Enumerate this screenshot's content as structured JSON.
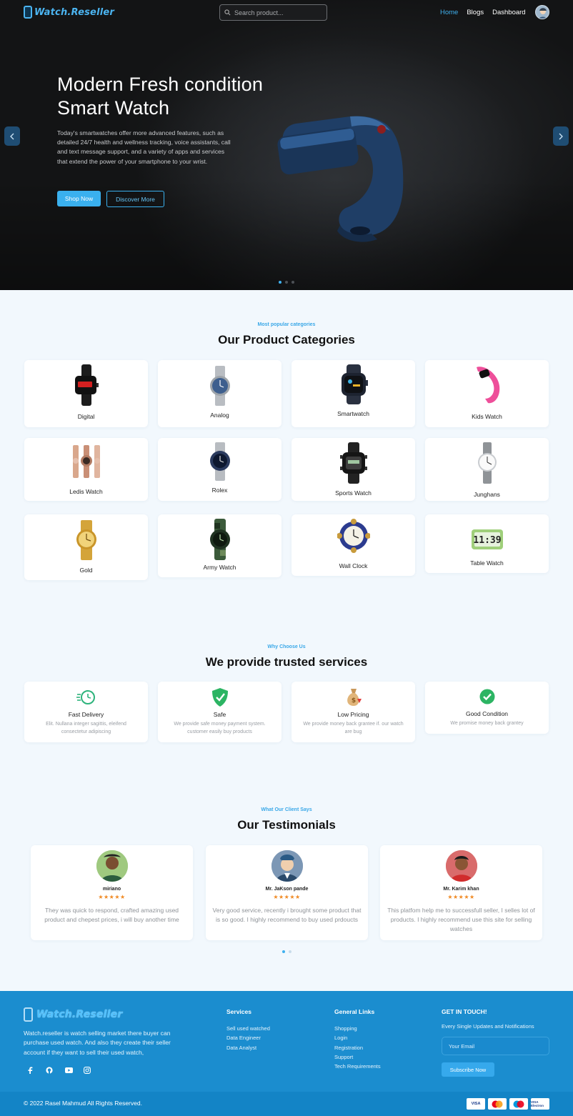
{
  "nav": {
    "brand": "Watch.Reseller",
    "search_placeholder": "Search product...",
    "links": [
      "Home",
      "Blogs",
      "Dashboard"
    ]
  },
  "hero": {
    "title_line1": "Modern Fresh condition",
    "title_line2": "Smart Watch",
    "description": "Today's smartwatches offer more advanced features, such as detailed 24/7 health and wellness tracking, voice assistants, call and text message support, and a variety of apps and services that extend the power of your smartphone to your wrist.",
    "primary_button": "Shop Now",
    "secondary_button": "Discover More"
  },
  "categories": {
    "subtitle": "Most popular categories",
    "title": "Our Product Categories",
    "items": [
      "Digital",
      "Analog",
      "Smartwatch",
      "Kids Watch",
      "Ledis Watch",
      "Rolex",
      "Sports Watch",
      "Junghans",
      "Gold",
      "Army Watch",
      "Wall Clock",
      "Table Watch"
    ]
  },
  "services": {
    "subtitle": "Why Choose Us",
    "title": "We provide trusted services",
    "items": [
      {
        "title": "Fast Delivery",
        "desc": "Elit. Nullana integer sagittis, eleifend consectetur adipiscing",
        "icon": "fast-delivery-icon"
      },
      {
        "title": "Safe",
        "desc": "We provide safe money payment system. customer easily buy products",
        "icon": "shield-check-icon"
      },
      {
        "title": "Low Pricing",
        "desc": "We provide money back grantee if. our watch are bug",
        "icon": "money-bag-icon"
      },
      {
        "title": "Good Condition",
        "desc": "We promise money back grantey",
        "icon": "check-circle-icon"
      }
    ]
  },
  "testimonials": {
    "subtitle": "What Our Client Says",
    "title": "Our Testimonials",
    "stars": "★★★★★",
    "items": [
      {
        "name": "miriano",
        "text": "They was quick to respond, crafted amazing used product and chepest prices, i will buy another time"
      },
      {
        "name": "Mr. JaKson pande",
        "text": "Very good service, recently i brought some product that is so good. I highly recommend to buy used prdoucts"
      },
      {
        "name": "Mr. Karim khan",
        "text": "This platfom help me to successfull seller, I selles lot of products. I highly recommend use this site for selling watches"
      }
    ]
  },
  "footer": {
    "brand": "Watch.Reseller",
    "about": "Watch.reseller is watch selling market there buyer can purchase used watch. And also they create their seller account if they want to sell their used watch,",
    "services_title": "Services",
    "services": [
      "Sell used watched",
      "Data Engineer",
      "Data Analyst"
    ],
    "links_title": "General Links",
    "links": [
      "Shopping",
      "Login",
      "Registration",
      "Support",
      "Tech Requirements"
    ],
    "contact_title": "GET IN TOUCH!",
    "contact_text": "Every Single Updates and Notifications",
    "email_placeholder": "Your Email",
    "subscribe": "Subscribe Now",
    "copyright": "© 2022 Rasel Mahmud All Rights Reserved.",
    "payments": [
      "VISA",
      "MC",
      "Maestro",
      "VISA Electron"
    ]
  },
  "colors": {
    "accent": "#3ab0ee",
    "footer": "#1b8dcf",
    "star": "#f08a24"
  }
}
